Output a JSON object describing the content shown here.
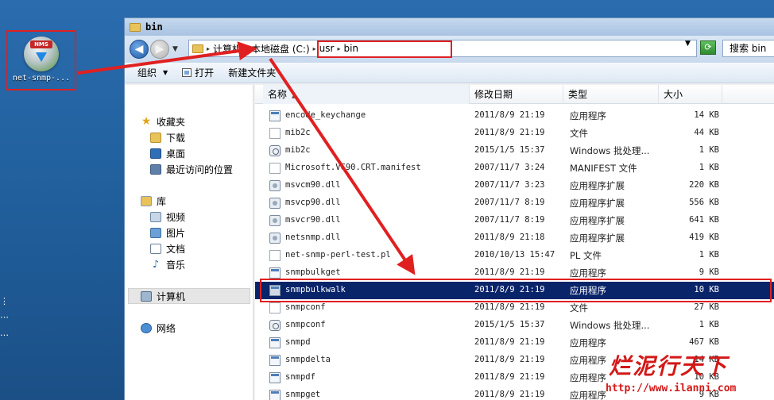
{
  "desktop": {
    "icon_label": "net-snmp-...",
    "icon_badge": "NMS",
    "edge_text": [
      "⋮",
      "⋯",
      "…"
    ]
  },
  "window": {
    "title": "bin",
    "address": {
      "segments": [
        "计算机",
        "本地磁盘 (C:)",
        "usr",
        "bin"
      ]
    },
    "search_label": "搜索 bin",
    "toolbar": {
      "organize": "组织",
      "open": "打开",
      "new_folder": "新建文件夹"
    },
    "nav": {
      "favorites": "收藏夹",
      "downloads": "下载",
      "desktop": "桌面",
      "recent": "最近访问的位置",
      "libraries": "库",
      "videos": "视频",
      "pictures": "图片",
      "documents": "文档",
      "music": "音乐",
      "computer": "计算机",
      "network": "网络"
    },
    "columns": {
      "name": "名称",
      "date": "修改日期",
      "type": "类型",
      "size": "大小"
    },
    "files": [
      {
        "name": "encode_keychange",
        "date": "2011/8/9 21:19",
        "type": "应用程序",
        "size": "14 KB",
        "icon": "exe"
      },
      {
        "name": "mib2c",
        "date": "2011/8/9 21:19",
        "type": "文件",
        "size": "44 KB",
        "icon": "doc"
      },
      {
        "name": "mib2c",
        "date": "2015/1/5 15:37",
        "type": "Windows 批处理...",
        "size": "1 KB",
        "icon": "bat"
      },
      {
        "name": "Microsoft.VC90.CRT.manifest",
        "date": "2007/11/7 3:24",
        "type": "MANIFEST 文件",
        "size": "1 KB",
        "icon": "doc"
      },
      {
        "name": "msvcm90.dll",
        "date": "2007/11/7 3:23",
        "type": "应用程序扩展",
        "size": "220 KB",
        "icon": "dll"
      },
      {
        "name": "msvcp90.dll",
        "date": "2007/11/7 8:19",
        "type": "应用程序扩展",
        "size": "556 KB",
        "icon": "dll"
      },
      {
        "name": "msvcr90.dll",
        "date": "2007/11/7 8:19",
        "type": "应用程序扩展",
        "size": "641 KB",
        "icon": "dll"
      },
      {
        "name": "netsnmp.dll",
        "date": "2011/8/9 21:18",
        "type": "应用程序扩展",
        "size": "419 KB",
        "icon": "dll"
      },
      {
        "name": "net-snmp-perl-test.pl",
        "date": "2010/10/13 15:47",
        "type": "PL 文件",
        "size": "1 KB",
        "icon": "doc"
      },
      {
        "name": "snmpbulkget",
        "date": "2011/8/9 21:19",
        "type": "应用程序",
        "size": "9 KB",
        "icon": "exe"
      },
      {
        "name": "snmpbulkwalk",
        "date": "2011/8/9 21:19",
        "type": "应用程序",
        "size": "10 KB",
        "icon": "exe"
      },
      {
        "name": "snmpconf",
        "date": "2011/8/9 21:19",
        "type": "文件",
        "size": "27 KB",
        "icon": "doc"
      },
      {
        "name": "snmpconf",
        "date": "2015/1/5 15:37",
        "type": "Windows 批处理...",
        "size": "1 KB",
        "icon": "bat"
      },
      {
        "name": "snmpd",
        "date": "2011/8/9 21:19",
        "type": "应用程序",
        "size": "467 KB",
        "icon": "exe"
      },
      {
        "name": "snmpdelta",
        "date": "2011/8/9 21:19",
        "type": "应用程序",
        "size": "14 KB",
        "icon": "exe"
      },
      {
        "name": "snmpdf",
        "date": "2011/8/9 21:19",
        "type": "应用程序",
        "size": "10 KB",
        "icon": "exe"
      },
      {
        "name": "snmpget",
        "date": "2011/8/9 21:19",
        "type": "应用程序",
        "size": "9 KB",
        "icon": "exe"
      }
    ],
    "selected_index": 10
  },
  "watermark": {
    "big": "烂泥行天下",
    "url": "http://www.ilanni.com"
  },
  "colors": {
    "annotation": "#e02020",
    "selection": "#0a246a"
  }
}
